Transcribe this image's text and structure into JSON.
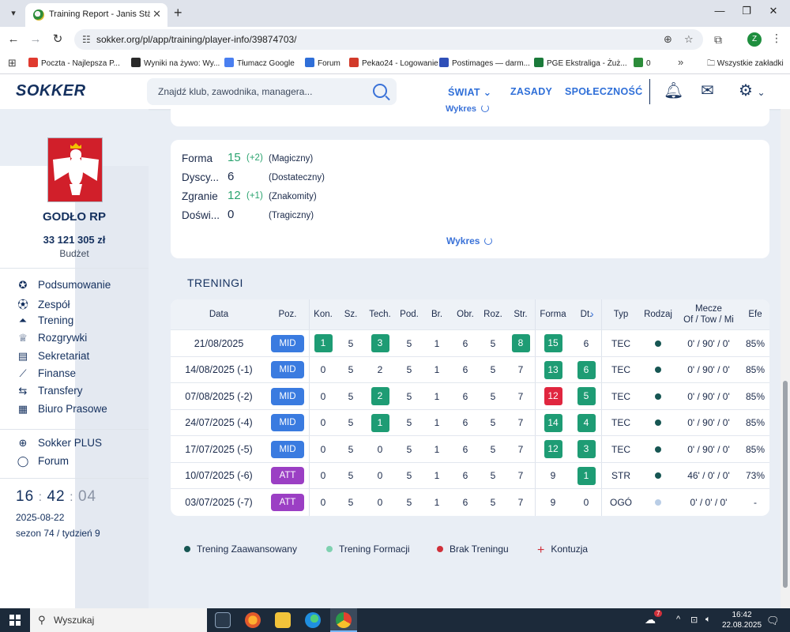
{
  "browser": {
    "tab_title": "Training Report - Janis Stämpfli",
    "url": "sokker.org/pl/app/training/player-info/39874703/",
    "profile_initial": "Z",
    "bookmarks": [
      {
        "label": "Poczta - Najlepsza P...",
        "color": "#e03a2f"
      },
      {
        "label": "Wyniki na żywo: Wy...",
        "color": "#2a2a2a"
      },
      {
        "label": "Tłumacz Google",
        "color": "#4a7ff0"
      },
      {
        "label": "Forum",
        "color": "#2f6fd8"
      },
      {
        "label": "Pekao24 - Logowanie",
        "color": "#d23a2a"
      },
      {
        "label": "Postimages — darm...",
        "color": "#2f4fb8"
      },
      {
        "label": "PGE Ekstraliga - Żuż...",
        "color": "#1b7a3a"
      },
      {
        "label": "0",
        "color": "#2c8c3a"
      }
    ],
    "bookmarks_folder": "Wszystkie zakładki"
  },
  "header": {
    "logo": "SOKKER",
    "search_placeholder": "Znajdź klub, zawodnika, managera...",
    "nav": [
      "ŚWIAT",
      "ZASADY",
      "SPOŁECZNOŚĆ"
    ]
  },
  "sidebar": {
    "club_name": "GODŁO RP",
    "budget": "33 121 305 zł",
    "budget_label": "Budżet",
    "watermark": "GODŁO",
    "menu": [
      {
        "label": "Podsumowanie",
        "icon": "medal-icon"
      },
      {
        "label": "Zespół",
        "icon": "ball-icon"
      },
      {
        "label": "Trening",
        "icon": "cone-icon"
      },
      {
        "label": "Rozgrywki",
        "icon": "trophy-icon"
      },
      {
        "label": "Sekretariat",
        "icon": "inbox-icon"
      },
      {
        "label": "Finanse",
        "icon": "chart-icon"
      },
      {
        "label": "Transfery",
        "icon": "arrows-icon"
      },
      {
        "label": "Biuro Prasowe",
        "icon": "newspaper-icon"
      }
    ],
    "menu2": [
      {
        "label": "Sokker PLUS",
        "icon": "plus-circle-icon"
      },
      {
        "label": "Forum",
        "icon": "forum-icon"
      }
    ],
    "clock": {
      "h": "16",
      "m": "42",
      "s": "04"
    },
    "date": "2025-08-22",
    "season": "sezon 74 / tydzień 9"
  },
  "stats_card": {
    "items": [
      {
        "name": "Forma",
        "value": "15",
        "diff": "(+2)",
        "desc": "(Magiczny)",
        "green": true
      },
      {
        "name": "Dyscy...",
        "value": "6",
        "diff": "",
        "desc": "(Dostateczny)",
        "green": false
      },
      {
        "name": "Zgranie",
        "value": "12",
        "diff": "(+1)",
        "desc": "(Znakomity)",
        "green": true
      },
      {
        "name": "Doświ...",
        "value": "0",
        "diff": "",
        "desc": "(Tragiczny)",
        "green": false
      }
    ],
    "chart_link": "Wykres"
  },
  "top_card_link": "Wykres",
  "trainings": {
    "title": "TRENINGI",
    "headers": [
      "Data",
      "Poz.",
      "Kon.",
      "Sz.",
      "Tech.",
      "Pod.",
      "Br.",
      "Obr.",
      "Roz.",
      "Str.",
      "Forma",
      "Dt.",
      "Typ",
      "Rodzaj",
      "Mecze\nOf / Tow / Mi",
      "Efe"
    ],
    "rows": [
      {
        "date": "21/08/2025",
        "pos": "MID",
        "kon": "1",
        "sz": "5",
        "tech": "3",
        "pod": "5",
        "br": "1",
        "obr": "6",
        "roz": "5",
        "str": "8",
        "forma": "15",
        "dt": "6",
        "typ": "TEC",
        "rodzaj": "#175653",
        "mecze": "0' / 90' / 0'",
        "efe": "85%",
        "hl": {
          "kon": "#1e9c74",
          "tech": "#1e9c74",
          "str": "#1e9c74",
          "forma": "#1e9c74"
        }
      },
      {
        "date": "14/08/2025 (-1)",
        "pos": "MID",
        "kon": "0",
        "sz": "5",
        "tech": "2",
        "pod": "5",
        "br": "1",
        "obr": "6",
        "roz": "5",
        "str": "7",
        "forma": "13",
        "dt": "6",
        "typ": "TEC",
        "rodzaj": "#175653",
        "mecze": "0' / 90' / 0'",
        "efe": "85%",
        "hl": {
          "forma": "#1e9c74",
          "dt": "#1e9c74"
        }
      },
      {
        "date": "07/08/2025 (-2)",
        "pos": "MID",
        "kon": "0",
        "sz": "5",
        "tech": "2",
        "pod": "5",
        "br": "1",
        "obr": "6",
        "roz": "5",
        "str": "7",
        "forma": "12",
        "dt": "5",
        "typ": "TEC",
        "rodzaj": "#175653",
        "mecze": "0' / 90' / 0'",
        "efe": "85%",
        "hl": {
          "tech": "#1e9c74",
          "forma": "#e0263f",
          "dt": "#1e9c74"
        }
      },
      {
        "date": "24/07/2025 (-4)",
        "pos": "MID",
        "kon": "0",
        "sz": "5",
        "tech": "1",
        "pod": "5",
        "br": "1",
        "obr": "6",
        "roz": "5",
        "str": "7",
        "forma": "14",
        "dt": "4",
        "typ": "TEC",
        "rodzaj": "#175653",
        "mecze": "0' / 90' / 0'",
        "efe": "85%",
        "hl": {
          "tech": "#1e9c74",
          "forma": "#1e9c74",
          "dt": "#1e9c74"
        }
      },
      {
        "date": "17/07/2025 (-5)",
        "pos": "MID",
        "kon": "0",
        "sz": "5",
        "tech": "0",
        "pod": "5",
        "br": "1",
        "obr": "6",
        "roz": "5",
        "str": "7",
        "forma": "12",
        "dt": "3",
        "typ": "TEC",
        "rodzaj": "#175653",
        "mecze": "0' / 90' / 0'",
        "efe": "85%",
        "hl": {
          "forma": "#1e9c74",
          "dt": "#1e9c74"
        }
      },
      {
        "date": "10/07/2025 (-6)",
        "pos": "ATT",
        "kon": "0",
        "sz": "5",
        "tech": "0",
        "pod": "5",
        "br": "1",
        "obr": "6",
        "roz": "5",
        "str": "7",
        "forma": "9",
        "dt": "1",
        "typ": "STR",
        "rodzaj": "#175653",
        "mecze": "46' / 0' / 0'",
        "efe": "73%",
        "hl": {
          "dt": "#1e9c74"
        }
      },
      {
        "date": "03/07/2025 (-7)",
        "pos": "ATT",
        "kon": "0",
        "sz": "5",
        "tech": "0",
        "pod": "5",
        "br": "1",
        "obr": "6",
        "roz": "5",
        "str": "7",
        "forma": "9",
        "dt": "0",
        "typ": "OGÓ",
        "rodzaj": "#b9cde6",
        "mecze": "0' / 0' / 0'",
        "efe": "-",
        "hl": {}
      }
    ]
  },
  "legend": [
    {
      "label": "Trening Zaawansowany",
      "color": "#175653",
      "kind": "dot"
    },
    {
      "label": "Trening Formacji",
      "color": "#7fd1b0",
      "kind": "dot"
    },
    {
      "label": "Brak Treningu",
      "color": "#d0303a",
      "kind": "dot"
    },
    {
      "label": "Kontuzja",
      "color": "#d0303a",
      "kind": "plus"
    }
  ],
  "taskbar": {
    "search_placeholder": "Wyszukaj",
    "weather_badge": "7",
    "time": "16:42",
    "date": "22.08.2025"
  }
}
